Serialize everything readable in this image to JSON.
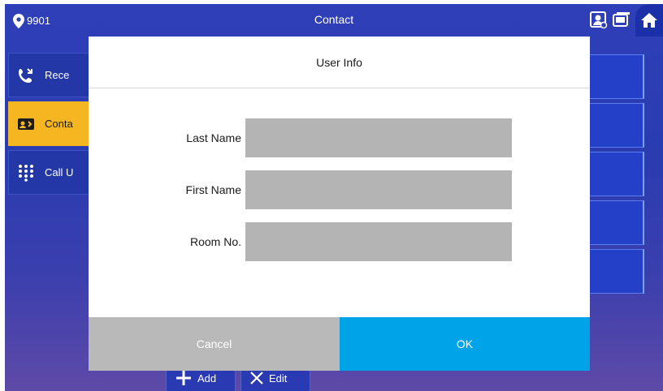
{
  "header": {
    "room_number": "9901",
    "title": "Contact",
    "icons": [
      "location-pin-icon",
      "user-settings-icon",
      "monitor-icon",
      "home-icon"
    ]
  },
  "sidebar": {
    "items": [
      {
        "label": "Rece",
        "icon": "call-log-icon",
        "active": false
      },
      {
        "label": "Conta",
        "icon": "contact-card-icon",
        "active": true
      },
      {
        "label": "Call U",
        "icon": "dialpad-icon",
        "active": false
      }
    ]
  },
  "bottom_bar": {
    "add_label": "Add",
    "edit_label": "Edit"
  },
  "dialog": {
    "title": "User Info",
    "fields": [
      {
        "label": "Last Name",
        "value": ""
      },
      {
        "label": "First Name",
        "value": ""
      },
      {
        "label": "Room No.",
        "value": ""
      }
    ],
    "cancel_label": "Cancel",
    "ok_label": "OK"
  },
  "colors": {
    "background": "#2e3fb8",
    "active_item": "#f5b621",
    "ok_button": "#00a3e8",
    "cancel_button": "#b9b9b9",
    "input_fill": "#b4b4b4"
  }
}
